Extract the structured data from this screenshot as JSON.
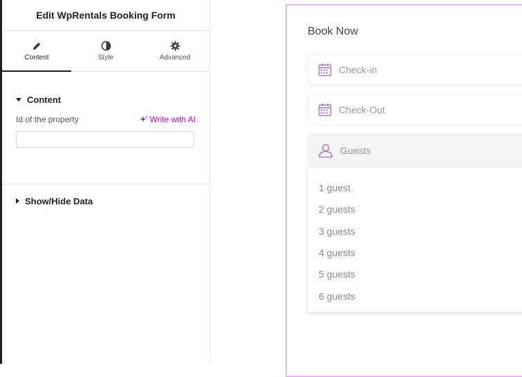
{
  "panel": {
    "title": "Edit WpRentals Booking Form",
    "tabs": [
      {
        "label": "Content",
        "icon": "pencil-icon",
        "active": true
      },
      {
        "label": "Style",
        "icon": "half-circle-icon",
        "active": false
      },
      {
        "label": "Advanced",
        "icon": "gear-icon",
        "active": false
      }
    ],
    "content_section": {
      "title": "Content",
      "field_label": "Id of the property",
      "ai_label": "Write with AI",
      "input_value": ""
    },
    "show_hide_section": {
      "title": "Show/Hide Data"
    }
  },
  "form": {
    "title": "Book Now",
    "checkin_placeholder": "Check-in",
    "checkout_placeholder": "Check-Out",
    "guests_placeholder": "Guests",
    "guest_options": [
      "1 guest",
      "2 guests",
      "3 guests",
      "4 guests",
      "5 guests",
      "6 guests"
    ]
  },
  "colors": {
    "accent": "#c400d8",
    "icon_purple": "#a679d2",
    "widget_border": "#e6b4ee"
  }
}
